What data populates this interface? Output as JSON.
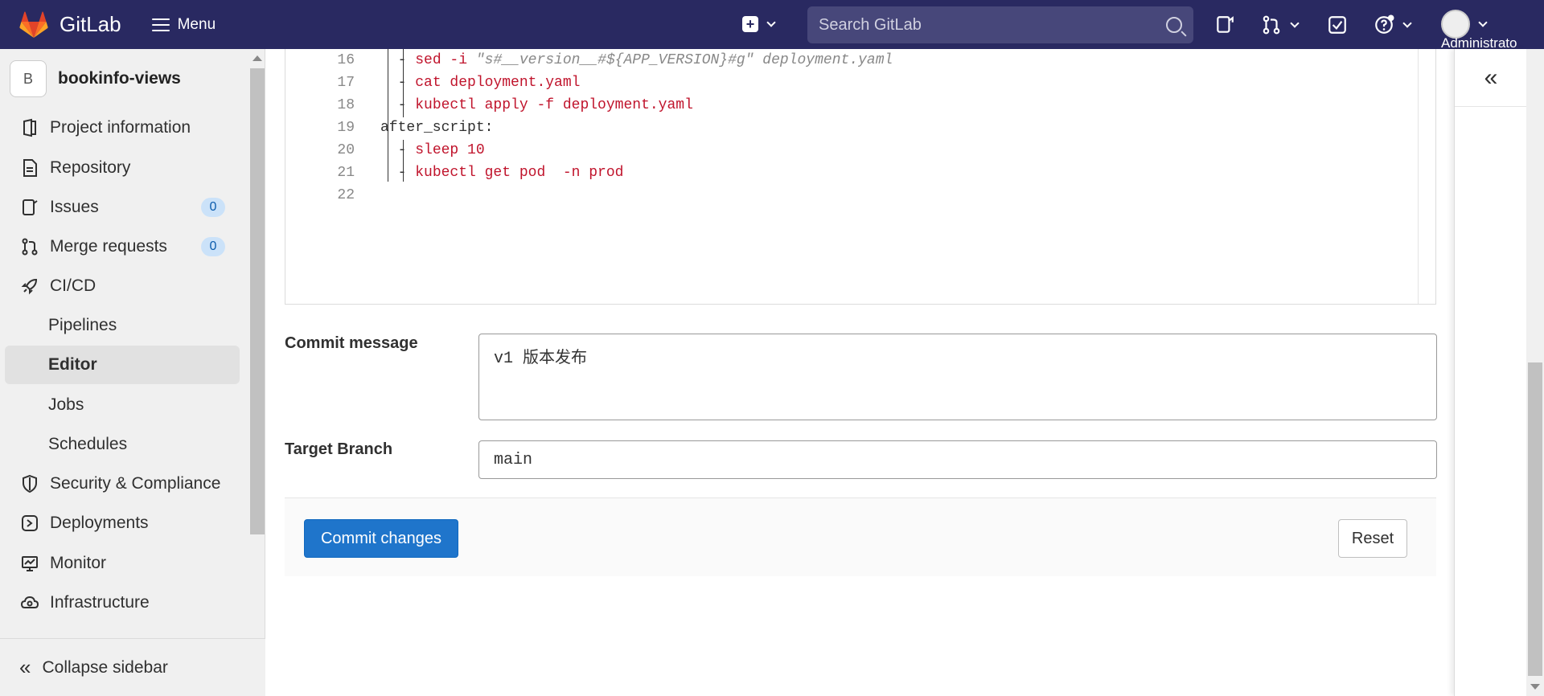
{
  "topbar": {
    "brand": "GitLab",
    "menu_label": "Menu",
    "search_placeholder": "Search GitLab",
    "user_label": "Administrato"
  },
  "sidebar": {
    "project_initial": "B",
    "project_name": "bookinfo-views",
    "items": [
      {
        "label": "Project information",
        "icon": "info-icon"
      },
      {
        "label": "Repository",
        "icon": "document-icon"
      },
      {
        "label": "Issues",
        "icon": "issues-icon",
        "badge": "0"
      },
      {
        "label": "Merge requests",
        "icon": "merge-request-icon",
        "badge": "0"
      },
      {
        "label": "CI/CD",
        "icon": "rocket-icon"
      },
      {
        "label": "Pipelines"
      },
      {
        "label": "Editor"
      },
      {
        "label": "Jobs"
      },
      {
        "label": "Schedules"
      },
      {
        "label": "Security & Compliance",
        "icon": "shield-icon"
      },
      {
        "label": "Deployments",
        "icon": "deployments-icon"
      },
      {
        "label": "Monitor",
        "icon": "monitor-icon"
      },
      {
        "label": "Infrastructure",
        "icon": "cloud-gear-icon"
      }
    ],
    "collapse_label": "Collapse sidebar"
  },
  "editor": {
    "lines": [
      {
        "num": "16",
        "text": "  - sed -i \"s#__version__#${APP_VERSION}#g\" deployment.yaml"
      },
      {
        "num": "17",
        "text": "  - cat deployment.yaml"
      },
      {
        "num": "18",
        "text": "  - kubectl apply -f deployment.yaml"
      },
      {
        "num": "19",
        "text": "after_script:"
      },
      {
        "num": "20",
        "text": "  - sleep 10"
      },
      {
        "num": "21",
        "text": "  - kubectl get pod  -n prod"
      },
      {
        "num": "22",
        "text": ""
      }
    ]
  },
  "form": {
    "commit_label": "Commit message",
    "commit_value": "v1 版本发布",
    "branch_label": "Target Branch",
    "branch_value": "main",
    "commit_button": "Commit changes",
    "reset_button": "Reset"
  },
  "colors": {
    "nav_bg": "#292961",
    "primary": "#1f75cb",
    "code_string": "#c0142c"
  }
}
